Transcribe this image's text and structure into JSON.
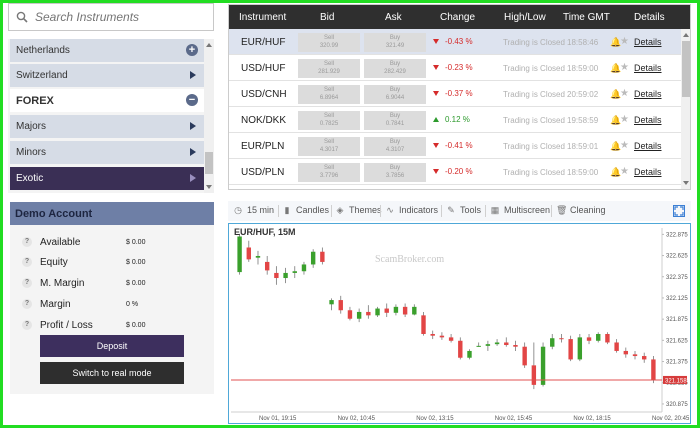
{
  "search": {
    "placeholder": "Search Instruments"
  },
  "categories": {
    "netherlands": "Netherlands",
    "switzerland": "Switzerland",
    "forex": "FOREX",
    "majors": "Majors",
    "minors": "Minors",
    "exotic": "Exotic"
  },
  "account": {
    "title": "Demo Account",
    "rows": [
      {
        "label": "Available",
        "value": "$ 0.00"
      },
      {
        "label": "Equity",
        "value": "$ 0.00"
      },
      {
        "label": "M. Margin",
        "value": "$ 0.00"
      },
      {
        "label": "Margin",
        "value": "0 %"
      },
      {
        "label": "Profit / Loss",
        "value": "$ 0.00"
      }
    ],
    "deposit_label": "Deposit",
    "real_label": "Switch to real mode",
    "help_icon": "?"
  },
  "table": {
    "headers": {
      "instrument": "Instrument",
      "bid": "Bid",
      "ask": "Ask",
      "change": "Change",
      "highlow": "High/Low",
      "time": "Time GMT",
      "details": "Details"
    },
    "sell_label": "Sell",
    "buy_label": "Buy",
    "details_link": "Details",
    "rows": [
      {
        "instrument": "EUR/HUF",
        "bid": "320.99",
        "ask": "321.49",
        "change": "-0.43 %",
        "direction": "down",
        "status": "Trading is Closed",
        "time": "18:58:46"
      },
      {
        "instrument": "USD/HUF",
        "bid": "281.929",
        "ask": "282.429",
        "change": "-0.23 %",
        "direction": "down",
        "status": "Trading is Closed",
        "time": "18:59:00"
      },
      {
        "instrument": "USD/CNH",
        "bid": "6.8964",
        "ask": "6.9044",
        "change": "-0.37 %",
        "direction": "down",
        "status": "Trading is Closed",
        "time": "20:59:02"
      },
      {
        "instrument": "NOK/DKK",
        "bid": "0.7825",
        "ask": "0.7841",
        "change": "0.12 %",
        "direction": "up",
        "status": "Trading is Closed",
        "time": "19:58:59"
      },
      {
        "instrument": "EUR/PLN",
        "bid": "4.3017",
        "ask": "4.3107",
        "change": "-0.41 %",
        "direction": "down",
        "status": "Trading is Closed",
        "time": "18:59:01"
      },
      {
        "instrument": "USD/PLN",
        "bid": "3.7796",
        "ask": "3.7856",
        "change": "-0.20 %",
        "direction": "down",
        "status": "Trading is Closed",
        "time": "18:59:00"
      }
    ]
  },
  "toolbar": {
    "interval": "15 min",
    "candles": "Candles",
    "themes": "Themes",
    "indicators": "Indicators",
    "tools": "Tools",
    "multiscreen": "Multiscreen",
    "cleaning": "Cleaning"
  },
  "chart": {
    "title": "EUR/HUF, 15M",
    "watermark": "ScamBroker.com",
    "current_price_label": "321.158",
    "up_color": "#3aa02c",
    "down_color": "#e24545",
    "price_line_color": "#e05050"
  },
  "chart_data": {
    "type": "candlestick",
    "symbol": "EUR/HUF",
    "timeframe": "15M",
    "y_ticks": [
      "322.875",
      "322.625",
      "322.375",
      "322.125",
      "321.875",
      "321.625",
      "321.375",
      "321.125",
      "320.875"
    ],
    "ylim": [
      320.78,
      322.95
    ],
    "x_ticks": [
      "Nov 01, 19:15",
      "Nov 02, 10:45",
      "Nov 02, 13:15",
      "Nov 02, 15:45",
      "Nov 02, 18:15",
      "Nov 02, 20:45"
    ],
    "current_price": 321.158,
    "candles": [
      {
        "o": 322.43,
        "h": 322.88,
        "l": 322.4,
        "c": 322.85
      },
      {
        "o": 322.72,
        "h": 322.8,
        "l": 322.55,
        "c": 322.58
      },
      {
        "o": 322.6,
        "h": 322.68,
        "l": 322.52,
        "c": 322.62
      },
      {
        "o": 322.55,
        "h": 322.62,
        "l": 322.4,
        "c": 322.45
      },
      {
        "o": 322.42,
        "h": 322.5,
        "l": 322.28,
        "c": 322.36
      },
      {
        "o": 322.36,
        "h": 322.48,
        "l": 322.3,
        "c": 322.42
      },
      {
        "o": 322.42,
        "h": 322.5,
        "l": 322.36,
        "c": 322.44
      },
      {
        "o": 322.44,
        "h": 322.55,
        "l": 322.4,
        "c": 322.52
      },
      {
        "o": 322.52,
        "h": 322.7,
        "l": 322.48,
        "c": 322.67
      },
      {
        "o": 322.67,
        "h": 322.72,
        "l": 322.52,
        "c": 322.55
      },
      {
        "o": 322.05,
        "h": 322.12,
        "l": 321.98,
        "c": 322.1
      },
      {
        "o": 322.1,
        "h": 322.15,
        "l": 321.94,
        "c": 321.98
      },
      {
        "o": 321.98,
        "h": 322.02,
        "l": 321.86,
        "c": 321.88
      },
      {
        "o": 321.88,
        "h": 322.0,
        "l": 321.84,
        "c": 321.96
      },
      {
        "o": 321.96,
        "h": 322.04,
        "l": 321.88,
        "c": 321.92
      },
      {
        "o": 321.92,
        "h": 322.02,
        "l": 321.9,
        "c": 322.0
      },
      {
        "o": 322.0,
        "h": 322.06,
        "l": 321.9,
        "c": 321.95
      },
      {
        "o": 321.95,
        "h": 322.05,
        "l": 321.92,
        "c": 322.02
      },
      {
        "o": 322.02,
        "h": 322.06,
        "l": 321.9,
        "c": 321.93
      },
      {
        "o": 321.93,
        "h": 322.05,
        "l": 321.92,
        "c": 322.02
      },
      {
        "o": 321.92,
        "h": 321.96,
        "l": 321.68,
        "c": 321.7
      },
      {
        "o": 321.7,
        "h": 321.74,
        "l": 321.64,
        "c": 321.68
      },
      {
        "o": 321.68,
        "h": 321.72,
        "l": 321.63,
        "c": 321.66
      },
      {
        "o": 321.66,
        "h": 321.7,
        "l": 321.6,
        "c": 321.62
      },
      {
        "o": 321.62,
        "h": 321.66,
        "l": 321.4,
        "c": 321.42
      },
      {
        "o": 321.42,
        "h": 321.52,
        "l": 321.4,
        "c": 321.5
      },
      {
        "o": 321.55,
        "h": 321.6,
        "l": 321.55,
        "c": 321.56
      },
      {
        "o": 321.56,
        "h": 321.62,
        "l": 321.5,
        "c": 321.58
      },
      {
        "o": 321.58,
        "h": 321.64,
        "l": 321.56,
        "c": 321.6
      },
      {
        "o": 321.6,
        "h": 321.66,
        "l": 321.55,
        "c": 321.57
      },
      {
        "o": 321.57,
        "h": 321.62,
        "l": 321.5,
        "c": 321.55
      },
      {
        "o": 321.55,
        "h": 321.6,
        "l": 321.3,
        "c": 321.33
      },
      {
        "o": 321.33,
        "h": 321.6,
        "l": 321.05,
        "c": 321.1
      },
      {
        "o": 321.1,
        "h": 321.6,
        "l": 321.08,
        "c": 321.55
      },
      {
        "o": 321.55,
        "h": 321.7,
        "l": 321.52,
        "c": 321.65
      },
      {
        "o": 321.65,
        "h": 321.7,
        "l": 321.6,
        "c": 321.64
      },
      {
        "o": 321.64,
        "h": 321.68,
        "l": 321.38,
        "c": 321.4
      },
      {
        "o": 321.4,
        "h": 321.7,
        "l": 321.38,
        "c": 321.66
      },
      {
        "o": 321.66,
        "h": 321.7,
        "l": 321.58,
        "c": 321.62
      },
      {
        "o": 321.62,
        "h": 321.72,
        "l": 321.6,
        "c": 321.7
      },
      {
        "o": 321.7,
        "h": 321.72,
        "l": 321.58,
        "c": 321.6
      },
      {
        "o": 321.6,
        "h": 321.64,
        "l": 321.48,
        "c": 321.5
      },
      {
        "o": 321.5,
        "h": 321.54,
        "l": 321.42,
        "c": 321.46
      },
      {
        "o": 321.46,
        "h": 321.5,
        "l": 321.4,
        "c": 321.44
      },
      {
        "o": 321.44,
        "h": 321.48,
        "l": 321.36,
        "c": 321.4
      },
      {
        "o": 321.4,
        "h": 321.44,
        "l": 321.12,
        "c": 321.16
      }
    ]
  }
}
